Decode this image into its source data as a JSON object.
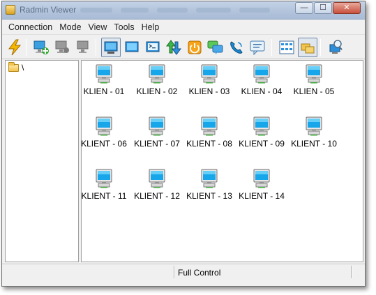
{
  "window": {
    "title": "Radmin Viewer",
    "controls": {
      "minimize": "—",
      "maximize": "☐",
      "close": "✕"
    }
  },
  "menu": [
    "Connection",
    "Mode",
    "View",
    "Tools",
    "Help"
  ],
  "toolbar": [
    "connect-lightning-icon",
    "add-connection-icon",
    "disconnect-icon",
    "properties-icon",
    "full-control-icon",
    "view-only-icon",
    "telnet-icon",
    "file-transfer-icon",
    "shutdown-icon",
    "text-chat-icon",
    "voice-chat-icon",
    "send-message-icon",
    "large-icons-view-icon",
    "folder-view-icon",
    "search-network-icon"
  ],
  "tree": {
    "root_label": "\\"
  },
  "hosts": [
    "KLIEN - 01",
    "KLIEN - 02",
    "KLIEN - 03",
    "KLIEN - 04",
    "KLIEN - 05",
    "KLIENT - 06",
    "KLIENT - 07",
    "KLIENT - 08",
    "KLIENT - 09",
    "KLIENT - 10",
    "KLIENT - 11",
    "KLIENT - 12",
    "KLIENT - 13",
    "KLIENT - 14"
  ],
  "status": {
    "mode": "Full Control"
  },
  "colors": {
    "accent": "#1e9be0",
    "titlebar": "#b4c5dc"
  }
}
